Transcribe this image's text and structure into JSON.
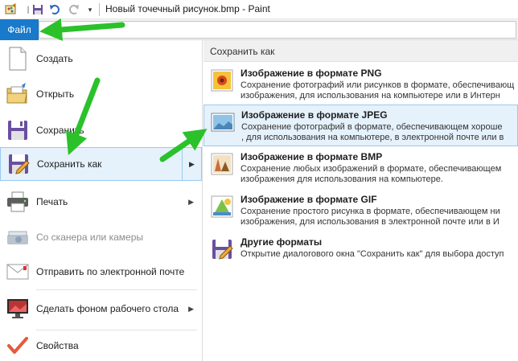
{
  "window": {
    "title": "Новый точечный рисунок.bmp - Paint"
  },
  "ribbon": {
    "file_tab": "Файл"
  },
  "left_menu": {
    "items": [
      {
        "label": "Создать",
        "icon": "new-document-icon"
      },
      {
        "label": "Открыть",
        "icon": "open-folder-icon"
      },
      {
        "label": "Сохранить",
        "icon": "save-icon"
      },
      {
        "label": "Сохранить как",
        "icon": "save-as-icon"
      },
      {
        "label": "Печать",
        "icon": "printer-icon"
      },
      {
        "label": "Со сканера или камеры",
        "icon": "scanner-icon"
      },
      {
        "label": "Отправить по электронной почте",
        "icon": "email-icon"
      },
      {
        "label": "Сделать фоном рабочего стола",
        "icon": "desktop-background-icon"
      },
      {
        "label": "Свойства",
        "icon": "properties-check-icon"
      }
    ]
  },
  "submenu": {
    "header": "Сохранить как",
    "items": [
      {
        "title": "Изображение в формате PNG",
        "desc1": "Сохранение фотографий или рисунков в формате, обеспечивающ",
        "desc2": "изображения, для использования на компьютере или в Интерн"
      },
      {
        "title": "Изображение в формате JPEG",
        "desc1": "Сохранение фотографий в формате, обеспечивающем хороше",
        "desc2": ", для использования на компьютере, в электронной почте или в"
      },
      {
        "title": "Изображение в формате BMP",
        "desc1": "Сохранение любых изображений в формате, обеспечивающем",
        "desc2": "изображения для использования на компьютере."
      },
      {
        "title": "Изображение в формате GIF",
        "desc1": "Сохранение простого рисунка в формате, обеспечивающем ни",
        "desc2": "изображения, для использования в электронной почте или в И"
      },
      {
        "title": "Другие форматы",
        "desc1": "Открытие диалогового окна \"Сохранить как\" для выбора доступ",
        "desc2": ""
      }
    ]
  },
  "colors": {
    "accent": "#1979ca",
    "hover_bg": "#e5f1fb",
    "hover_border": "#99c9ef",
    "annotation_arrow": "#2bc12b"
  }
}
